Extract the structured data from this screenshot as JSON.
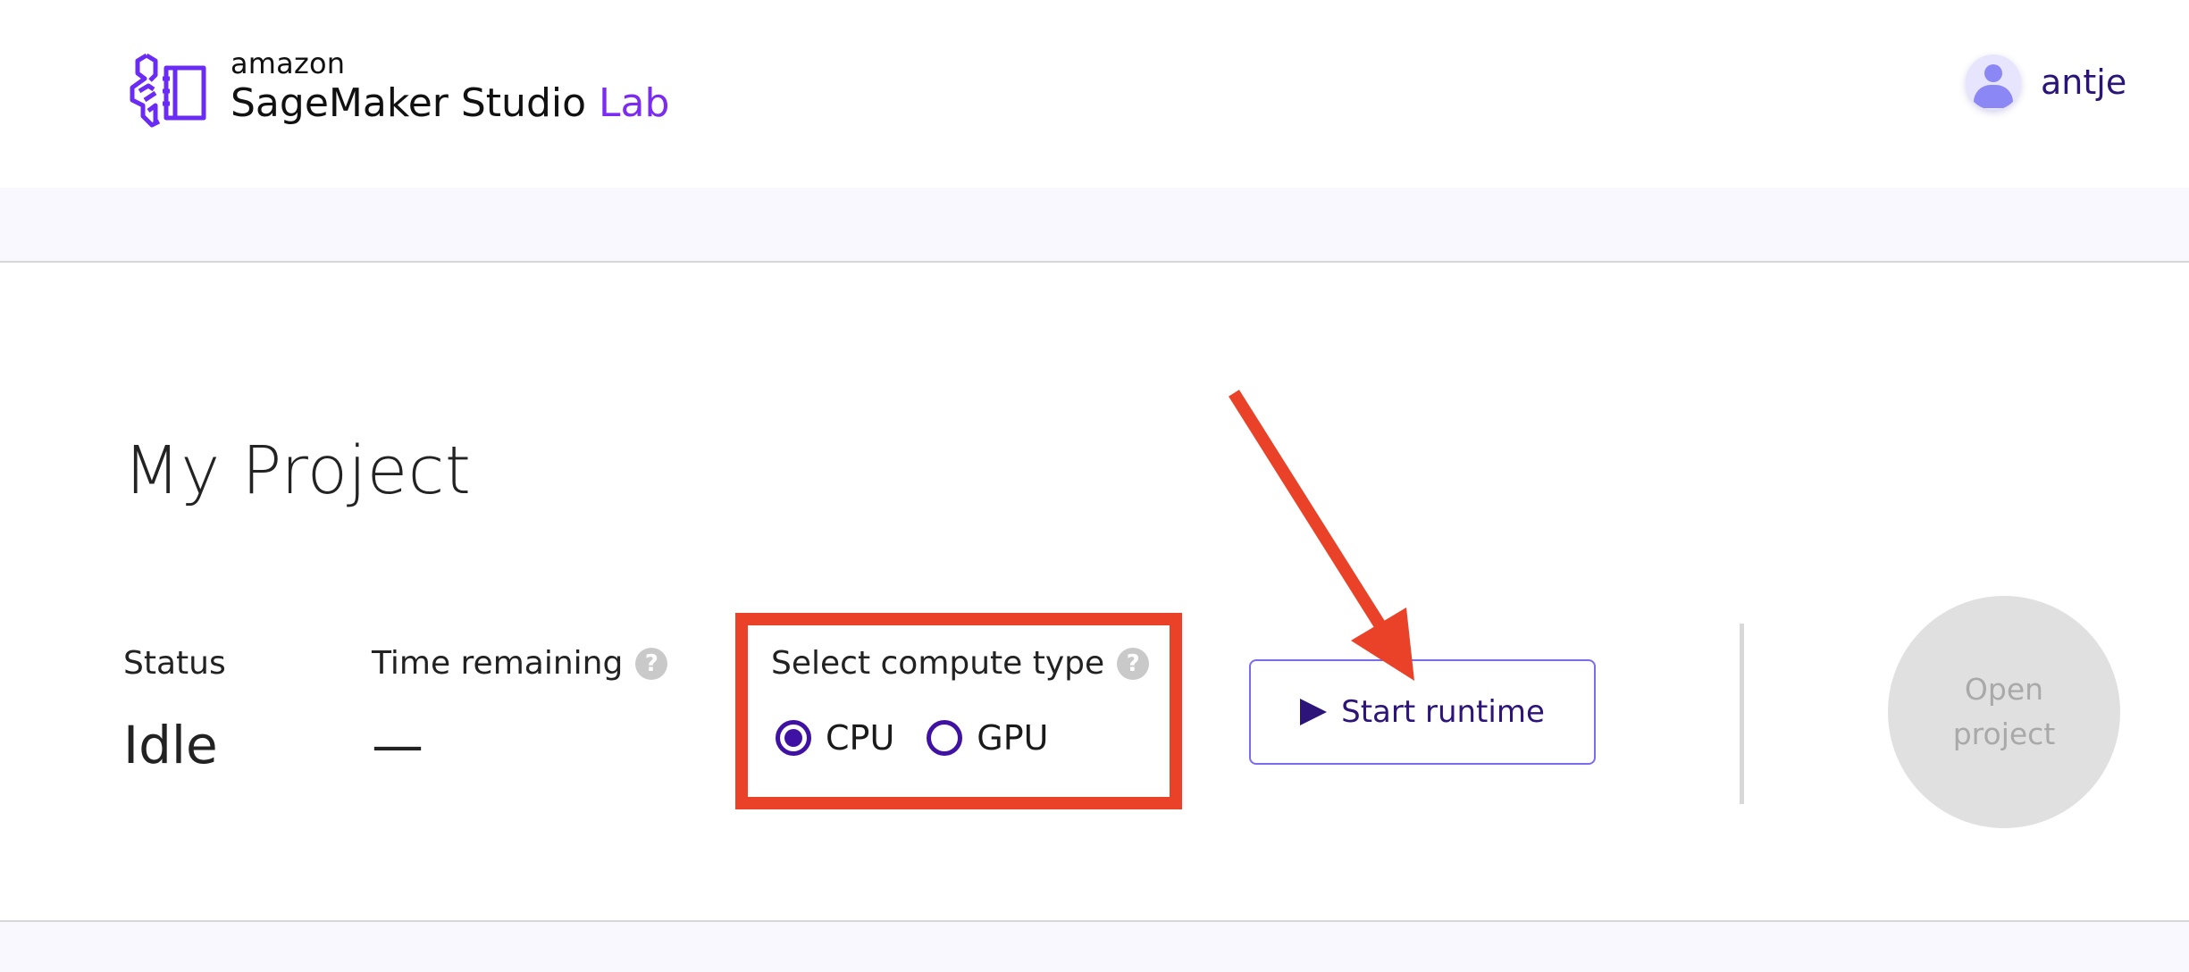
{
  "header": {
    "brand_small": "amazon",
    "brand_name": "SageMaker Studio",
    "brand_accent": "Lab",
    "logo_icon": "sagemaker-studio-lab-logo",
    "user": {
      "avatar_icon": "user-avatar-icon",
      "name": "antje"
    }
  },
  "project": {
    "title": "My Project",
    "status": {
      "label": "Status",
      "value": "Idle"
    },
    "time_remaining": {
      "label": "Time remaining",
      "value": "—",
      "help_icon": "?"
    },
    "compute": {
      "label": "Select compute type",
      "help_icon": "?",
      "options": [
        {
          "label": "CPU",
          "selected": true
        },
        {
          "label": "GPU",
          "selected": false
        }
      ]
    },
    "start_button": {
      "icon": "play-icon",
      "label": "Start runtime"
    },
    "open_button": {
      "line1": "Open",
      "line2": "project",
      "disabled": true
    }
  },
  "annotations": {
    "highlight_box": "compute-type-selector",
    "arrow_target": "start-runtime-button"
  },
  "colors": {
    "brand_accent": "#7b2cf0",
    "primary": "#3f12a3",
    "annotation": "#ea4228",
    "band_bg": "#f9f8fe"
  }
}
